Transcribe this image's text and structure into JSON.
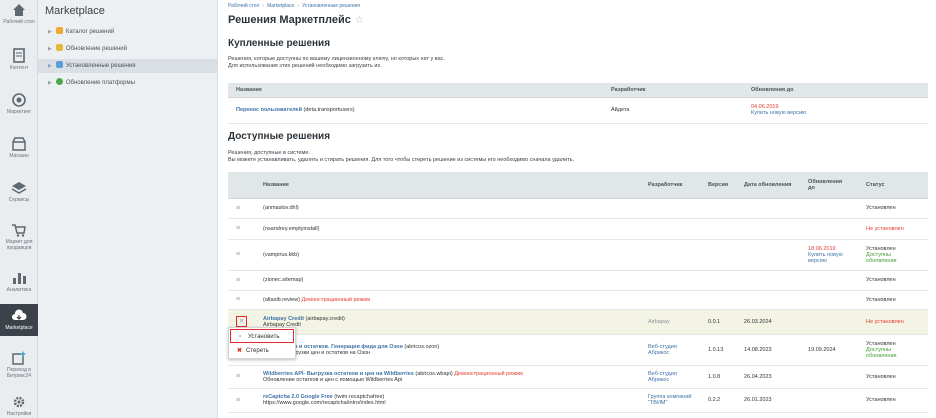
{
  "rail": [
    {
      "label": "Рабочий стол",
      "icon": "home-icon"
    },
    {
      "label": "Контент",
      "icon": "document-icon"
    },
    {
      "label": "Маркетинг",
      "icon": "target-icon"
    },
    {
      "label": "Магазин",
      "icon": "shop-icon"
    },
    {
      "label": "Сервисы",
      "icon": "layers-icon"
    },
    {
      "label": "Маркет для продавцов",
      "icon": "cart-icon"
    },
    {
      "label": "Аналитика",
      "icon": "chart-icon"
    },
    {
      "label": "Marketplace",
      "icon": "cloud-icon"
    },
    {
      "label": "Переход в Битрикс24",
      "icon": "sparkle-icon"
    },
    {
      "label": "Настройки",
      "icon": "gear-icon"
    }
  ],
  "menu": {
    "title": "Marketplace",
    "items": [
      {
        "label": "Каталог решений",
        "color": "#f0a830"
      },
      {
        "label": "Обновление решений",
        "color": "#e6b93a"
      },
      {
        "label": "Установленные решения",
        "color": "#5aa0d8"
      },
      {
        "label": "Обновление платформы",
        "color": "#4aa84a"
      }
    ]
  },
  "breadcrumbs": [
    "Рабочий стол",
    "Marketplace",
    "Установленные решения"
  ],
  "page_title": "Решения Маркетплейс",
  "purchased": {
    "title": "Купленные решения",
    "desc1": "Решения, которые доступны по вашему лицензионному ключу, но которых нет у вас.",
    "desc2": "Для использования этих решений необходимо загрузить их.",
    "headers": [
      "Название",
      "Разработчик",
      "Обновления до"
    ],
    "rows": [
      {
        "name": "Перенос пользователей",
        "code": "(deta.transportusers)",
        "developer": "Айдета",
        "date": "04.06.2019",
        "action": "Купить новую версию"
      }
    ]
  },
  "available": {
    "title": "Доступные решения",
    "desc1": "Решения, доступные в системе.",
    "desc2": "Вы можете устанавливать, удалять и стирать решения. Для того чтобы стереть решение из системы его необходимо сначала удалить.",
    "headers": [
      "Название",
      "Разработчик",
      "Версия",
      "Дата обновления",
      "Обновления до",
      "Статус"
    ],
    "rows": [
      {
        "name": "(anmaslov.dhl)",
        "status": "Установлен",
        "status_color": "normal"
      },
      {
        "name": "(nsandrey.emptyinstall)",
        "status": "Не установлен",
        "status_color": "red"
      },
      {
        "name": "(vampirus.kkb)",
        "upd_date": "18.06.2019",
        "upd_action": "Купить новую версию",
        "status": "Установлен",
        "status2": "Доступны обновления",
        "status_color": "normal"
      },
      {
        "name": "(zionec.sitemap)",
        "status": "Установлен",
        "status_color": "normal"
      },
      {
        "name": "(altasib.review)",
        "demo": "Демонстрационный режим",
        "status": "Установлен",
        "status_color": "normal"
      },
      {
        "name": "Airbapay Credit",
        "code": "(airbapay.credit)",
        "subtitle": "Airbapay Credit",
        "developer": "Airbapay",
        "version": "0.0.1",
        "date": "26.03.2024",
        "status": "Не установлен",
        "status_color": "red"
      },
      {
        "name": "грузка цен и остатков. Генерация фида для Озон",
        "code": "(abricos.ozon)",
        "subtitle": "ид для загрузки цен и остатков на Озон",
        "developer": "Веб-студия Абрикос",
        "version": "1.0.13",
        "date": "14.08.2023",
        "upd": "19.09.2024",
        "status": "Установлен",
        "status2": "Доступны обновления",
        "status_color": "normal"
      },
      {
        "name": "Wildberries API- Выгрузка остатков и цен на Wildberries",
        "code": "(abricos.wbapi)",
        "demo": "Демонстрационный режим",
        "subtitle": "Обновление остатков и цен с помощью Wildberries Api",
        "developer": "Веб-студия Абрикос",
        "version": "1.0.8",
        "date": "26.04.2023",
        "status": "Установлен",
        "status_color": "normal"
      },
      {
        "name": "reCaptcha 2.0 Google Free",
        "code": "(twim.recaptchafree)",
        "subtitle": "https://www.google.com/recaptcha/intro/index.html",
        "developer": "Группа компаний \"ТВИМ\"",
        "version": "0.2.2",
        "date": "26.01.2023",
        "status": "Установлен",
        "status_color": "normal"
      }
    ]
  },
  "context_menu": {
    "install": "Установить",
    "erase": "Стереть"
  },
  "colors": {
    "accent": "#3f73a6",
    "red": "#e23b2e",
    "green": "#3f9d2f"
  }
}
